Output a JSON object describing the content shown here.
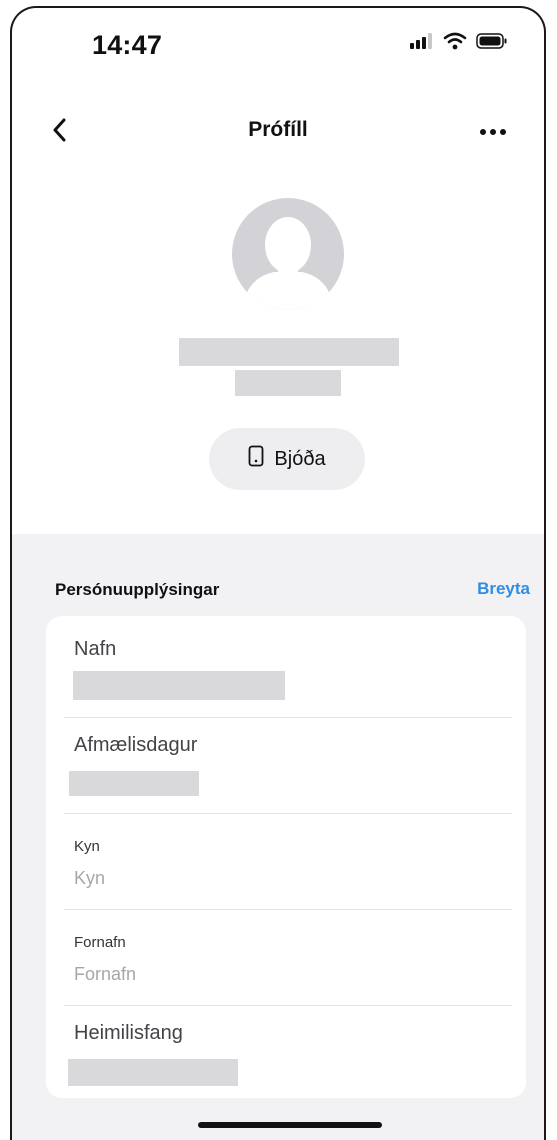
{
  "status_bar": {
    "time": "14:47",
    "icons": [
      "cellular-signal-icon",
      "wifi-icon",
      "battery-icon"
    ]
  },
  "nav": {
    "title": "Prófíll",
    "back_icon": "chevron-left-icon",
    "more_icon": "more-horizontal-icon"
  },
  "profile": {
    "avatar_icon": "person-avatar-icon",
    "invite_label": "Bjóða",
    "invite_icon": "phone-icon"
  },
  "section": {
    "title": "Persónuupplýsingar",
    "edit_label": "Breyta"
  },
  "fields": {
    "name": {
      "label": "Nafn"
    },
    "birthday": {
      "label": "Afmælisdagur"
    },
    "gender": {
      "label": "Kyn",
      "placeholder": "Kyn"
    },
    "pronoun": {
      "label": "Fornafn",
      "placeholder": "Fornafn"
    },
    "address": {
      "label": "Heimilisfang"
    }
  },
  "colors": {
    "accent": "#2f8de4",
    "background_section": "#f2f2f4",
    "redaction": "#d9d9dc",
    "placeholder_text": "#a6a6ad"
  }
}
